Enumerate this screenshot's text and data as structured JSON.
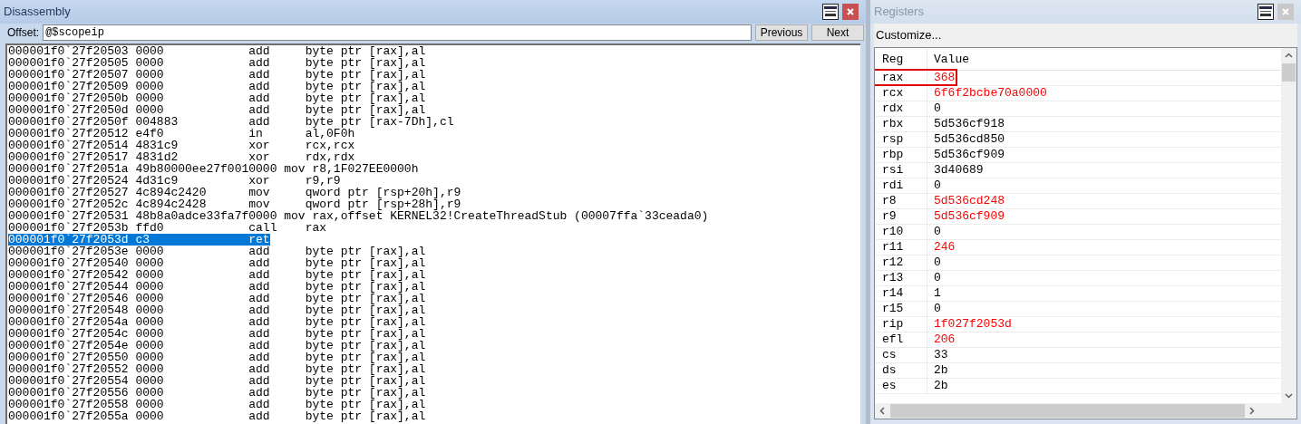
{
  "disassembly": {
    "title": "Disassembly",
    "active": true,
    "offset_label": "Offset:",
    "offset_value": "@$scopeip",
    "buttons": [
      "Previous",
      "Next"
    ],
    "lines": [
      {
        "text": "000001f0`27f20503 0000            add     byte ptr [rax],al",
        "selected": false
      },
      {
        "text": "000001f0`27f20505 0000            add     byte ptr [rax],al",
        "selected": false
      },
      {
        "text": "000001f0`27f20507 0000            add     byte ptr [rax],al",
        "selected": false
      },
      {
        "text": "000001f0`27f20509 0000            add     byte ptr [rax],al",
        "selected": false
      },
      {
        "text": "000001f0`27f2050b 0000            add     byte ptr [rax],al",
        "selected": false
      },
      {
        "text": "000001f0`27f2050d 0000            add     byte ptr [rax],al",
        "selected": false
      },
      {
        "text": "000001f0`27f2050f 004883          add     byte ptr [rax-7Dh],cl",
        "selected": false
      },
      {
        "text": "000001f0`27f20512 e4f0            in      al,0F0h",
        "selected": false
      },
      {
        "text": "000001f0`27f20514 4831c9          xor     rcx,rcx",
        "selected": false
      },
      {
        "text": "000001f0`27f20517 4831d2          xor     rdx,rdx",
        "selected": false
      },
      {
        "text": "000001f0`27f2051a 49b80000ee27f0010000 mov r8,1F027EE0000h",
        "selected": false
      },
      {
        "text": "000001f0`27f20524 4d31c9          xor     r9,r9",
        "selected": false
      },
      {
        "text": "000001f0`27f20527 4c894c2420      mov     qword ptr [rsp+20h],r9",
        "selected": false
      },
      {
        "text": "000001f0`27f2052c 4c894c2428      mov     qword ptr [rsp+28h],r9",
        "selected": false
      },
      {
        "text": "000001f0`27f20531 48b8a0adce33fa7f0000 mov rax,offset KERNEL32!CreateThreadStub (00007ffa`33ceada0)",
        "selected": false
      },
      {
        "text": "000001f0`27f2053b ffd0            call    rax",
        "selected": false
      },
      {
        "text": "000001f0`27f2053d c3              ret",
        "selected": true
      },
      {
        "text": "000001f0`27f2053e 0000            add     byte ptr [rax],al",
        "selected": false
      },
      {
        "text": "000001f0`27f20540 0000            add     byte ptr [rax],al",
        "selected": false
      },
      {
        "text": "000001f0`27f20542 0000            add     byte ptr [rax],al",
        "selected": false
      },
      {
        "text": "000001f0`27f20544 0000            add     byte ptr [rax],al",
        "selected": false
      },
      {
        "text": "000001f0`27f20546 0000            add     byte ptr [rax],al",
        "selected": false
      },
      {
        "text": "000001f0`27f20548 0000            add     byte ptr [rax],al",
        "selected": false
      },
      {
        "text": "000001f0`27f2054a 0000            add     byte ptr [rax],al",
        "selected": false
      },
      {
        "text": "000001f0`27f2054c 0000            add     byte ptr [rax],al",
        "selected": false
      },
      {
        "text": "000001f0`27f2054e 0000            add     byte ptr [rax],al",
        "selected": false
      },
      {
        "text": "000001f0`27f20550 0000            add     byte ptr [rax],al",
        "selected": false
      },
      {
        "text": "000001f0`27f20552 0000            add     byte ptr [rax],al",
        "selected": false
      },
      {
        "text": "000001f0`27f20554 0000            add     byte ptr [rax],al",
        "selected": false
      },
      {
        "text": "000001f0`27f20556 0000            add     byte ptr [rax],al",
        "selected": false
      },
      {
        "text": "000001f0`27f20558 0000            add     byte ptr [rax],al",
        "selected": false
      },
      {
        "text": "000001f0`27f2055a 0000            add     byte ptr [rax],al",
        "selected": false
      }
    ]
  },
  "registers": {
    "title": "Registers",
    "active": false,
    "customize_button": "Customize...",
    "columns": [
      "Reg",
      "Value"
    ],
    "rows": [
      {
        "reg": "rax",
        "value": "368",
        "changed": true,
        "outlined": true
      },
      {
        "reg": "rcx",
        "value": "6f6f2bcbe70a0000",
        "changed": true,
        "outlined": false
      },
      {
        "reg": "rdx",
        "value": "0",
        "changed": false,
        "outlined": false
      },
      {
        "reg": "rbx",
        "value": "5d536cf918",
        "changed": false,
        "outlined": false
      },
      {
        "reg": "rsp",
        "value": "5d536cd850",
        "changed": false,
        "outlined": false
      },
      {
        "reg": "rbp",
        "value": "5d536cf909",
        "changed": false,
        "outlined": false
      },
      {
        "reg": "rsi",
        "value": "3d40689",
        "changed": false,
        "outlined": false
      },
      {
        "reg": "rdi",
        "value": "0",
        "changed": false,
        "outlined": false
      },
      {
        "reg": "r8",
        "value": "5d536cd248",
        "changed": true,
        "outlined": false
      },
      {
        "reg": "r9",
        "value": "5d536cf909",
        "changed": true,
        "outlined": false
      },
      {
        "reg": "r10",
        "value": "0",
        "changed": false,
        "outlined": false
      },
      {
        "reg": "r11",
        "value": "246",
        "changed": true,
        "outlined": false
      },
      {
        "reg": "r12",
        "value": "0",
        "changed": false,
        "outlined": false
      },
      {
        "reg": "r13",
        "value": "0",
        "changed": false,
        "outlined": false
      },
      {
        "reg": "r14",
        "value": "1",
        "changed": false,
        "outlined": false
      },
      {
        "reg": "r15",
        "value": "0",
        "changed": false,
        "outlined": false
      },
      {
        "reg": "rip",
        "value": "1f027f2053d",
        "changed": true,
        "outlined": false
      },
      {
        "reg": "efl",
        "value": "206",
        "changed": true,
        "outlined": false
      },
      {
        "reg": "cs",
        "value": "33",
        "changed": false,
        "outlined": false
      },
      {
        "reg": "ds",
        "value": "2b",
        "changed": false,
        "outlined": false
      },
      {
        "reg": "es",
        "value": "2b",
        "changed": false,
        "outlined": false
      }
    ]
  }
}
